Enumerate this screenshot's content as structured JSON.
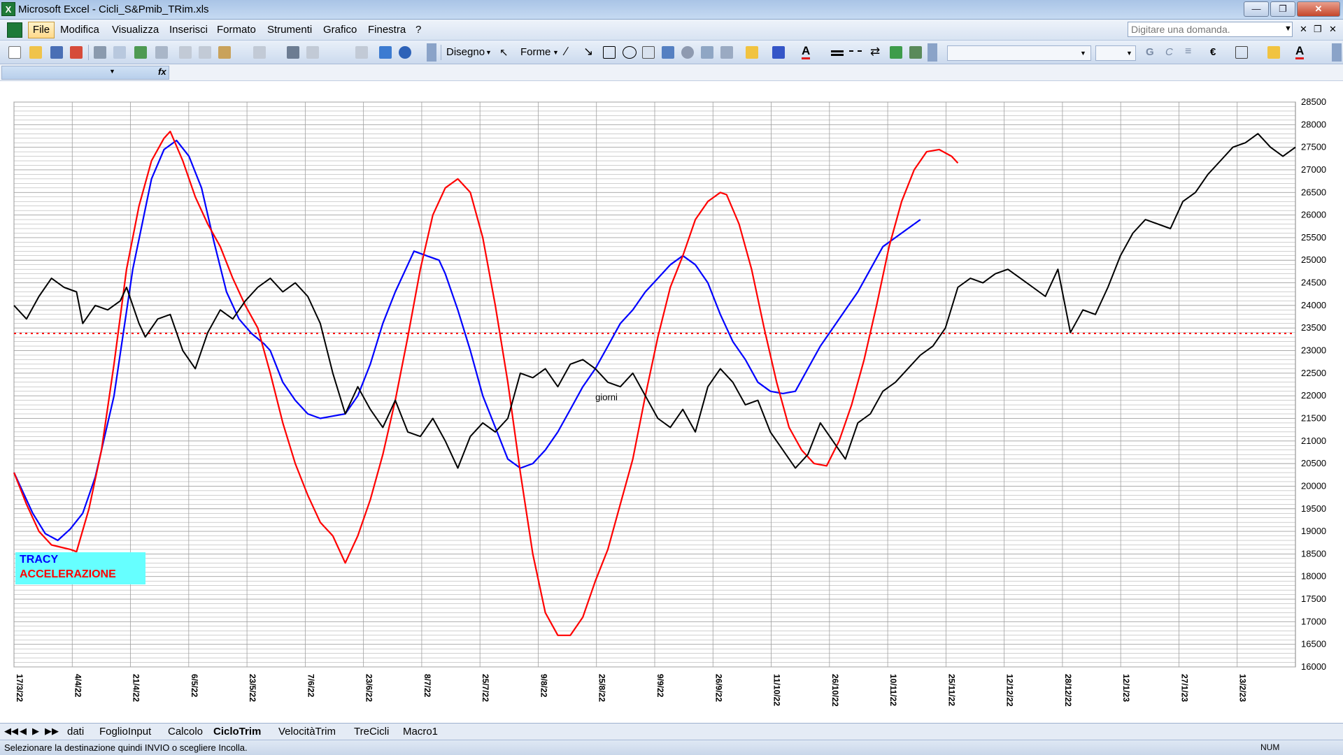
{
  "window": {
    "title": "Microsoft Excel - Cicli_S&Pmib_TRim.xls",
    "icon": "excel-app-icon",
    "controls": [
      "minimize-icon",
      "restore-icon",
      "close-icon"
    ]
  },
  "menu": {
    "items": [
      "File",
      "Modifica",
      "Visualizza",
      "Inserisci",
      "Formato",
      "Strumenti",
      "Grafico",
      "Finestra",
      "?"
    ],
    "search_placeholder": "Digitare una domanda."
  },
  "toolbar": {
    "drawing_label": "Disegno",
    "shapes_label": "Forme",
    "font_bold": "G",
    "font_italic": "C",
    "currency_symbol": "€"
  },
  "formula_bar": {
    "fx_label": "fx"
  },
  "chart_data": {
    "type": "line",
    "ylim": [
      16000,
      28500
    ],
    "y_ticks": [
      16000,
      16500,
      17000,
      17500,
      18000,
      18500,
      19000,
      19500,
      20000,
      20500,
      21000,
      21500,
      22000,
      22500,
      23000,
      23500,
      24000,
      24500,
      25000,
      25500,
      26000,
      26500,
      27000,
      27500,
      28000,
      28500
    ],
    "x_tick_labels": [
      "17/3/22",
      "4/4/22",
      "21/4/22",
      "6/5/22",
      "23/5/22",
      "7/6/22",
      "23/6/22",
      "8/7/22",
      "25/7/22",
      "9/8/22",
      "25/8/22",
      "9/9/22",
      "26/9/22",
      "11/10/22",
      "26/10/22",
      "10/11/22",
      "25/11/22",
      "12/12/22",
      "28/12/22",
      "12/1/23",
      "27/1/23",
      "13/2/23"
    ],
    "annotation": "giorni",
    "reference_line": {
      "value": 23380,
      "color": "#ff0000",
      "style": "dotted"
    },
    "series": [
      {
        "name": "TRACY",
        "color": "#0000ff",
        "points": [
          [
            0,
            20300
          ],
          [
            3,
            19400
          ],
          [
            5,
            18950
          ],
          [
            7,
            18800
          ],
          [
            9,
            19050
          ],
          [
            11,
            19400
          ],
          [
            13,
            20200
          ],
          [
            16,
            22000
          ],
          [
            19,
            24800
          ],
          [
            22,
            26800
          ],
          [
            24,
            27450
          ],
          [
            26,
            27650
          ],
          [
            28,
            27300
          ],
          [
            30,
            26600
          ],
          [
            32,
            25400
          ],
          [
            34,
            24300
          ],
          [
            36,
            23700
          ],
          [
            38,
            23380
          ],
          [
            40,
            23150
          ],
          [
            41,
            23000
          ],
          [
            43,
            22300
          ],
          [
            45,
            21900
          ],
          [
            47,
            21600
          ],
          [
            49,
            21500
          ],
          [
            51,
            21550
          ],
          [
            53,
            21600
          ],
          [
            55,
            22000
          ],
          [
            57,
            22700
          ],
          [
            59,
            23600
          ],
          [
            61,
            24300
          ],
          [
            63,
            24900
          ],
          [
            64,
            25200
          ],
          [
            66,
            25100
          ],
          [
            68,
            25000
          ],
          [
            69,
            24700
          ],
          [
            71,
            23900
          ],
          [
            73,
            23000
          ],
          [
            75,
            22000
          ],
          [
            77,
            21300
          ],
          [
            79,
            20600
          ],
          [
            81,
            20400
          ],
          [
            83,
            20500
          ],
          [
            85,
            20800
          ],
          [
            87,
            21200
          ],
          [
            89,
            21700
          ],
          [
            91,
            22200
          ],
          [
            93,
            22600
          ],
          [
            95,
            23100
          ],
          [
            97,
            23600
          ],
          [
            99,
            23900
          ],
          [
            101,
            24300
          ],
          [
            103,
            24600
          ],
          [
            105,
            24900
          ],
          [
            107,
            25100
          ],
          [
            109,
            24900
          ],
          [
            111,
            24500
          ],
          [
            113,
            23800
          ],
          [
            115,
            23200
          ],
          [
            117,
            22800
          ],
          [
            119,
            22300
          ],
          [
            121,
            22100
          ],
          [
            123,
            22050
          ],
          [
            125,
            22100
          ],
          [
            127,
            22600
          ],
          [
            129,
            23100
          ],
          [
            131,
            23500
          ],
          [
            133,
            23900
          ],
          [
            135,
            24300
          ],
          [
            137,
            24800
          ],
          [
            139,
            25300
          ],
          [
            141,
            25500
          ],
          [
            143,
            25700
          ],
          [
            145,
            25900
          ]
        ]
      },
      {
        "name": "ACCELERAZIONE",
        "color": "#ff0000",
        "points": [
          [
            0,
            20300
          ],
          [
            2,
            19600
          ],
          [
            4,
            19000
          ],
          [
            6,
            18700
          ],
          [
            9,
            18600
          ],
          [
            10,
            18550
          ],
          [
            12,
            19500
          ],
          [
            14,
            20800
          ],
          [
            16,
            22700
          ],
          [
            18,
            24800
          ],
          [
            20,
            26200
          ],
          [
            22,
            27200
          ],
          [
            24,
            27700
          ],
          [
            25,
            27850
          ],
          [
            27,
            27200
          ],
          [
            29,
            26400
          ],
          [
            31,
            25800
          ],
          [
            33,
            25300
          ],
          [
            35,
            24600
          ],
          [
            37,
            24000
          ],
          [
            39,
            23500
          ],
          [
            41,
            22500
          ],
          [
            43,
            21400
          ],
          [
            45,
            20500
          ],
          [
            47,
            19800
          ],
          [
            49,
            19200
          ],
          [
            51,
            18900
          ],
          [
            53,
            18300
          ],
          [
            55,
            18900
          ],
          [
            57,
            19700
          ],
          [
            59,
            20700
          ],
          [
            61,
            21900
          ],
          [
            63,
            23300
          ],
          [
            65,
            24800
          ],
          [
            67,
            26000
          ],
          [
            69,
            26600
          ],
          [
            71,
            26800
          ],
          [
            73,
            26500
          ],
          [
            75,
            25500
          ],
          [
            77,
            24000
          ],
          [
            79,
            22300
          ],
          [
            81,
            20300
          ],
          [
            83,
            18500
          ],
          [
            85,
            17200
          ],
          [
            87,
            16700
          ],
          [
            89,
            16700
          ],
          [
            91,
            17100
          ],
          [
            93,
            17900
          ],
          [
            95,
            18600
          ],
          [
            97,
            19600
          ],
          [
            99,
            20600
          ],
          [
            101,
            22000
          ],
          [
            103,
            23300
          ],
          [
            105,
            24400
          ],
          [
            107,
            25100
          ],
          [
            109,
            25900
          ],
          [
            111,
            26300
          ],
          [
            113,
            26500
          ],
          [
            114,
            26450
          ],
          [
            116,
            25800
          ],
          [
            118,
            24800
          ],
          [
            120,
            23500
          ],
          [
            122,
            22300
          ],
          [
            124,
            21300
          ],
          [
            126,
            20800
          ],
          [
            128,
            20500
          ],
          [
            130,
            20450
          ],
          [
            132,
            21000
          ],
          [
            134,
            21800
          ],
          [
            136,
            22800
          ],
          [
            138,
            24000
          ],
          [
            140,
            25300
          ],
          [
            142,
            26300
          ],
          [
            144,
            27000
          ],
          [
            146,
            27400
          ],
          [
            148,
            27450
          ],
          [
            150,
            27300
          ],
          [
            151,
            27150
          ]
        ]
      },
      {
        "name": "",
        "color": "#000000",
        "points": [
          [
            0,
            24000
          ],
          [
            2,
            23700
          ],
          [
            4,
            24200
          ],
          [
            6,
            24600
          ],
          [
            8,
            24400
          ],
          [
            10,
            24300
          ],
          [
            11,
            23600
          ],
          [
            13,
            24000
          ],
          [
            15,
            23900
          ],
          [
            17,
            24100
          ],
          [
            18,
            24400
          ],
          [
            20,
            23600
          ],
          [
            21,
            23300
          ],
          [
            23,
            23700
          ],
          [
            25,
            23800
          ],
          [
            27,
            23000
          ],
          [
            29,
            22600
          ],
          [
            31,
            23400
          ],
          [
            33,
            23900
          ],
          [
            35,
            23700
          ],
          [
            37,
            24100
          ],
          [
            39,
            24400
          ],
          [
            41,
            24600
          ],
          [
            43,
            24300
          ],
          [
            45,
            24500
          ],
          [
            47,
            24200
          ],
          [
            49,
            23600
          ],
          [
            51,
            22500
          ],
          [
            53,
            21600
          ],
          [
            55,
            22200
          ],
          [
            57,
            21700
          ],
          [
            59,
            21300
          ],
          [
            61,
            21900
          ],
          [
            63,
            21200
          ],
          [
            65,
            21100
          ],
          [
            67,
            21500
          ],
          [
            69,
            21000
          ],
          [
            71,
            20400
          ],
          [
            73,
            21100
          ],
          [
            75,
            21400
          ],
          [
            77,
            21200
          ],
          [
            79,
            21500
          ],
          [
            81,
            22500
          ],
          [
            83,
            22400
          ],
          [
            85,
            22600
          ],
          [
            87,
            22200
          ],
          [
            89,
            22700
          ],
          [
            91,
            22800
          ],
          [
            93,
            22600
          ],
          [
            95,
            22300
          ],
          [
            97,
            22200
          ],
          [
            99,
            22500
          ],
          [
            101,
            22000
          ],
          [
            103,
            21500
          ],
          [
            105,
            21300
          ],
          [
            107,
            21700
          ],
          [
            109,
            21200
          ],
          [
            111,
            22200
          ],
          [
            113,
            22600
          ],
          [
            115,
            22300
          ],
          [
            117,
            21800
          ],
          [
            119,
            21900
          ],
          [
            121,
            21200
          ],
          [
            123,
            20800
          ],
          [
            125,
            20400
          ],
          [
            127,
            20700
          ],
          [
            129,
            21400
          ],
          [
            131,
            21000
          ],
          [
            133,
            20600
          ],
          [
            135,
            21400
          ],
          [
            137,
            21600
          ],
          [
            139,
            22100
          ],
          [
            141,
            22300
          ],
          [
            143,
            22600
          ],
          [
            145,
            22900
          ],
          [
            147,
            23100
          ],
          [
            149,
            23500
          ],
          [
            151,
            24400
          ],
          [
            153,
            24600
          ],
          [
            155,
            24500
          ],
          [
            157,
            24700
          ],
          [
            159,
            24800
          ],
          [
            161,
            24600
          ],
          [
            163,
            24400
          ],
          [
            165,
            24200
          ],
          [
            167,
            24800
          ],
          [
            169,
            23400
          ],
          [
            171,
            23900
          ],
          [
            173,
            23800
          ],
          [
            175,
            24400
          ],
          [
            177,
            25100
          ],
          [
            179,
            25600
          ],
          [
            181,
            25900
          ],
          [
            183,
            25800
          ],
          [
            185,
            25700
          ],
          [
            187,
            26300
          ],
          [
            189,
            26500
          ],
          [
            191,
            26900
          ],
          [
            193,
            27200
          ],
          [
            195,
            27500
          ],
          [
            197,
            27600
          ],
          [
            199,
            27800
          ],
          [
            201,
            27500
          ],
          [
            203,
            27300
          ],
          [
            205,
            27500
          ]
        ]
      }
    ],
    "legend": {
      "placement": "bottom-left",
      "background": "#66ffff"
    }
  },
  "sheet_tabs": [
    "dati",
    "FoglioInput",
    "Calcolo",
    "CicloTrim",
    "VelocitàTrim",
    "TreCicli",
    "Macro1"
  ],
  "active_tab": "CicloTrim",
  "status": {
    "message": "Selezionare la destinazione quindi INVIO o scegliere Incolla.",
    "num": "NUM"
  }
}
